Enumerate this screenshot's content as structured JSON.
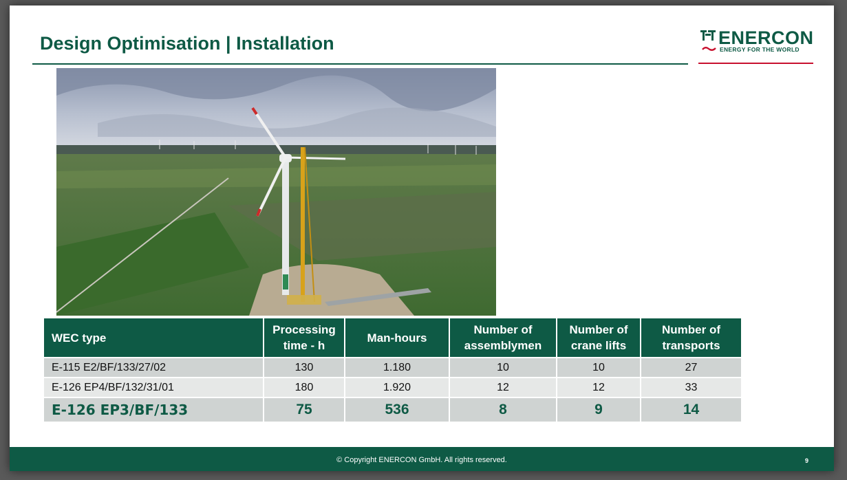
{
  "slide": {
    "title": "Design Optimisation | Installation"
  },
  "logo": {
    "brand": "ENERCON",
    "tagline": "ENERGY FOR THE WORLD",
    "colors": {
      "green": "#0e5a45",
      "red": "#c8102e"
    }
  },
  "photo": {
    "subject": "wind-turbine-installation-aerial-photo"
  },
  "table": {
    "headers": [
      "WEC type",
      "Processing time - h",
      "Man-hours",
      "Number of assemblymen",
      "Number of crane lifts",
      "Number of transports"
    ],
    "header_lines": {
      "processing": [
        "Processing",
        "time - h"
      ],
      "assemblymen": [
        "Number of",
        "assemblymen"
      ],
      "crane": [
        "Number of",
        "crane lifts"
      ],
      "transports": [
        "Number of",
        "transports"
      ]
    },
    "rows": [
      [
        "E-115 E2/BF/133/27/02",
        "130",
        "1.180",
        "10",
        "10",
        "27"
      ],
      [
        "E-126 EP4/BF/132/31/01",
        "180",
        "1.920",
        "12",
        "12",
        "33"
      ],
      [
        "E-126 EP3/BF/133",
        "75",
        "536",
        "8",
        "9",
        "14"
      ]
    ]
  },
  "footer": {
    "copyright": "© Copyright ENERCON GmbH. All rights reserved.",
    "page_number": "9"
  }
}
